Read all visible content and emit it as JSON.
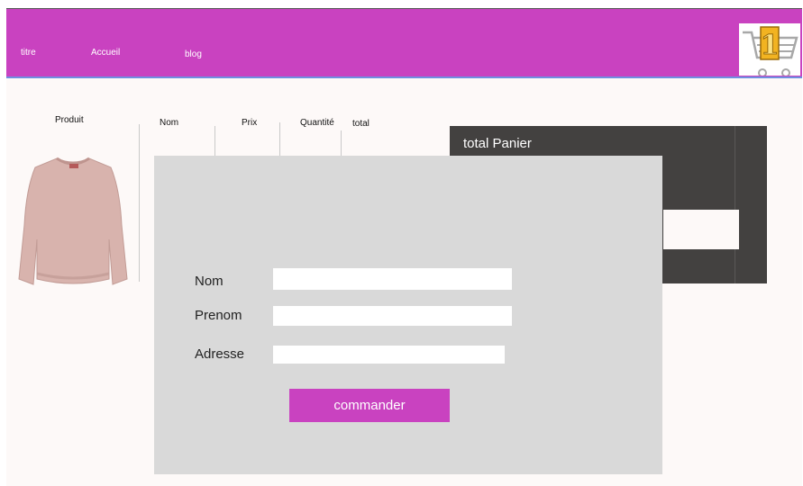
{
  "nav": {
    "titre": "titre",
    "accueil": "Accueil",
    "blog": "blog"
  },
  "cart_icon": "shopping-cart-icon",
  "badge_text": "1",
  "table": {
    "produit": "Produit",
    "nom": "Nom",
    "prix": "Prix",
    "quantite": "Quantité",
    "total": "total"
  },
  "product_image": "sweater-image",
  "panier": {
    "title": "total Panier"
  },
  "form": {
    "nom_label": "Nom",
    "prenom_label": "Prenom",
    "adresse_label": "Adresse",
    "nom_value": "",
    "prenom_value": "",
    "adresse_value": "",
    "submit_label": "commander"
  },
  "colors": {
    "brand": "#c942c0",
    "dark_panel": "#434140",
    "modal": "#d9d9d9",
    "page": "#fdf9f8"
  }
}
